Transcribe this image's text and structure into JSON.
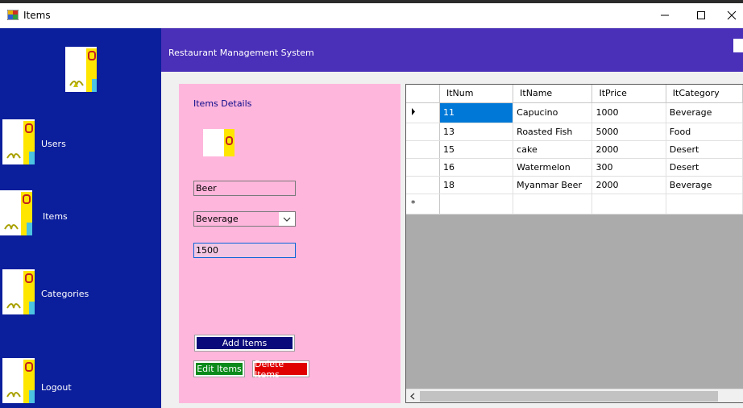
{
  "window": {
    "title": "Items"
  },
  "header": {
    "title": "Restaurant Management System"
  },
  "sidebar": {
    "items": [
      {
        "label": "Users"
      },
      {
        "label": "Items"
      },
      {
        "label": "Categories"
      },
      {
        "label": "Logout"
      }
    ]
  },
  "details": {
    "title": "Items Details",
    "name_value": "Beer",
    "category_value": "Beverage",
    "price_value": "1500",
    "add_label": "Add Items",
    "edit_label": "Edit Items",
    "delete_label": "Delete Items"
  },
  "grid": {
    "columns": [
      "ItNum",
      "ItName",
      "ItPrice",
      "ItCategory"
    ],
    "rows": [
      [
        "11",
        "Capucino",
        "1000",
        "Beverage"
      ],
      [
        "13",
        "Roasted Fish",
        "5000",
        "Food"
      ],
      [
        "15",
        "cake",
        "2000",
        "Desert"
      ],
      [
        "16",
        "Watermelon",
        "300",
        "Desert"
      ],
      [
        "18",
        "Myanmar Beer",
        "2000",
        "Beverage"
      ]
    ]
  },
  "colors": {
    "sidebar": "#0b1e9c",
    "header": "#4a2fb8",
    "panel": "#ffb6dc",
    "add_button": "#0a0a7a",
    "edit_button": "#0a8a1a",
    "delete_button": "#e00000",
    "selection": "#0078d7"
  }
}
